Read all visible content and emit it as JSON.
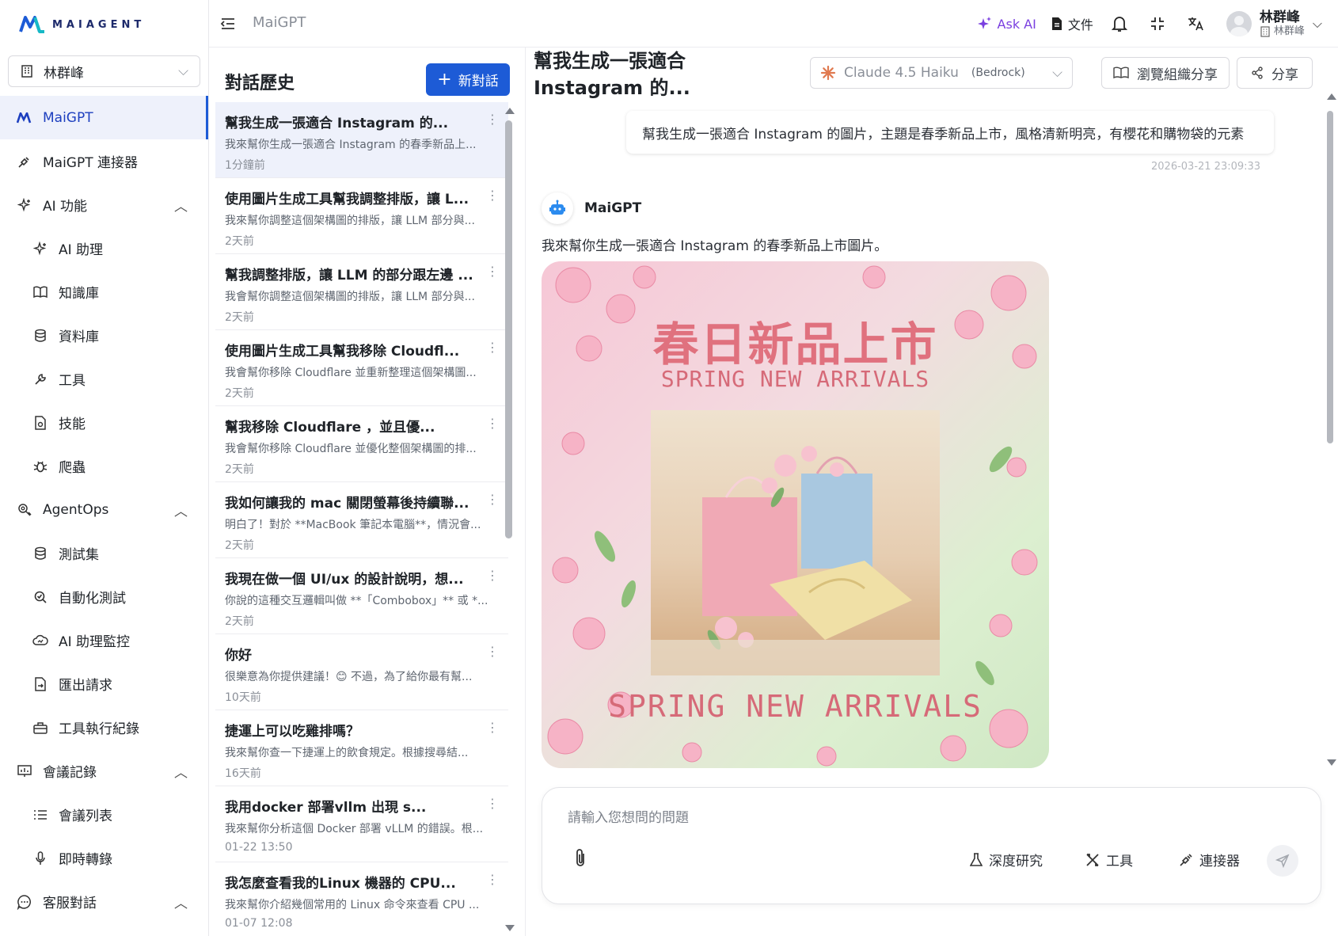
{
  "brand": {
    "logo_text": "MAIAGENT"
  },
  "org_select": {
    "value": "林群峰"
  },
  "sidebar": {
    "items": [
      {
        "label": "MaiGPT",
        "icon": "maiagent-logo-icon",
        "active": true
      },
      {
        "label": "MaiGPT 連接器",
        "icon": "plug-icon"
      },
      {
        "label": "AI 功能",
        "icon": "sparkle-icon",
        "expanded": true
      },
      {
        "label": "AI 助理",
        "icon": "sparkle-icon",
        "sub": true
      },
      {
        "label": "知識庫",
        "icon": "book-icon",
        "sub": true
      },
      {
        "label": "資料庫",
        "icon": "database-icon",
        "sub": true
      },
      {
        "label": "工具",
        "icon": "wrench-icon",
        "sub": true
      },
      {
        "label": "技能",
        "icon": "file-code-icon",
        "sub": true
      },
      {
        "label": "爬蟲",
        "icon": "bug-icon",
        "sub": true
      },
      {
        "label": "AgentOps",
        "icon": "agentops-icon",
        "expanded": true
      },
      {
        "label": "測試集",
        "icon": "database-icon",
        "sub": true
      },
      {
        "label": "自動化測試",
        "icon": "search-check-icon",
        "sub": true
      },
      {
        "label": "AI 助理監控",
        "icon": "cloud-monitor-icon",
        "sub": true
      },
      {
        "label": "匯出請求",
        "icon": "file-export-icon",
        "sub": true
      },
      {
        "label": "工具執行紀錄",
        "icon": "toolbox-icon",
        "sub": true
      },
      {
        "label": "會議記錄",
        "icon": "presentation-icon",
        "expanded": true
      },
      {
        "label": "會議列表",
        "icon": "list-icon",
        "sub": true
      },
      {
        "label": "即時轉錄",
        "icon": "mic-icon",
        "sub": true
      },
      {
        "label": "客服對話",
        "icon": "chat-bubble-icon",
        "expanded": true
      }
    ]
  },
  "topbar": {
    "breadcrumb": "MaiGPT",
    "ask_ai": "Ask AI",
    "docs": "文件",
    "user_name": "林群峰",
    "user_org": "林群峰"
  },
  "history": {
    "title": "對話歷史",
    "new_chat": "新對話",
    "items": [
      {
        "title": "幫我生成一張適合 Instagram 的...",
        "snippet": "我來幫你生成一張適合 Instagram 的春季新品上...",
        "time": "1分鐘前",
        "active": true
      },
      {
        "title": "使用圖片生成工具幫我調整排版，讓 L...",
        "snippet": "我來幫你調整這個架構圖的排版，讓 LLM 部分與...",
        "time": "2天前"
      },
      {
        "title": "幫我調整排版，讓 LLM 的部分跟左邊 ...",
        "snippet": "我會幫你調整這個架構圖的排版，讓 LLM 部分與...",
        "time": "2天前"
      },
      {
        "title": "使用圖片生成工具幫我移除 Cloudfl...",
        "snippet": "我會幫你移除 Cloudflare 並重新整理這個架構圖...",
        "time": "2天前"
      },
      {
        "title": "幫我移除 Cloudflare ，並且優...",
        "snippet": "我會幫你移除 Cloudflare 並優化整個架構圖的排...",
        "time": "2天前"
      },
      {
        "title": "我如何讓我的 mac 關閉螢幕後持續聯...",
        "snippet": "明白了！對於 **MacBook 筆記本電腦**，情況會...",
        "time": "2天前"
      },
      {
        "title": "我現在做一個 UI/ux 的設計說明，想...",
        "snippet": "你說的這種交互邏輯叫做 **「Combobox」** 或 *...",
        "time": "2天前"
      },
      {
        "title": "你好",
        "snippet": "很樂意為你提供建議！😊 不過，為了給你最有幫...",
        "time": "10天前"
      },
      {
        "title": "捷運上可以吃雞排嗎？",
        "snippet": "我來幫你查一下捷運上的飲食規定。根據搜尋結...",
        "time": "16天前"
      },
      {
        "title": "我用docker 部署vllm 出現 s...",
        "snippet": "我來幫你分析這個 Docker 部署 vLLM 的錯誤。根...",
        "time": "01-22 13:50"
      },
      {
        "title": "我怎麼查看我的Linux 機器的 CPU...",
        "snippet": "我來幫你介紹幾個常用的 Linux 命令來查看 CPU ...",
        "time": "01-07 12:08"
      }
    ]
  },
  "chat": {
    "title": "幫我生成一張適合 Instagram 的...",
    "model": "Claude 4.5 Haiku",
    "provider": "(Bedrock)",
    "browse_share": "瀏覽組織分享",
    "share": "分享",
    "user_message": "幫我生成一張適合 Instagram 的圖片，主題是春季新品上市，風格清新明亮，有櫻花和購物袋的元素",
    "user_time": "2026-03-21 23:09:33",
    "bot_name": "MaiGPT",
    "bot_text": "我來幫你生成一張適合 Instagram 的春季新品上市圖片。",
    "image": {
      "title_cn": "春日新品上市",
      "subtitle_top": "SPRING NEW ARRIVALS",
      "subtitle_bottom": "SPRING NEW ARRIVALS"
    }
  },
  "composer": {
    "placeholder": "請輸入您想問的問題",
    "deep_research": "深度研究",
    "tools": "工具",
    "connectors": "連接器"
  },
  "colors": {
    "primary": "#1d5bd6",
    "ask_ai": "#7a3fe0",
    "active_bg": "#eef1fb"
  }
}
